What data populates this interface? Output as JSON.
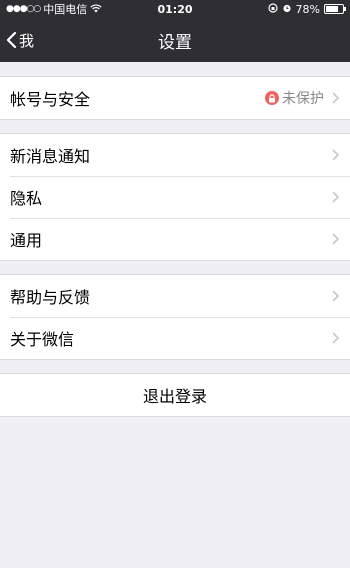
{
  "status_bar": {
    "signal": "●●●○○",
    "carrier": "中国电信",
    "time": "01:20",
    "battery": "78%",
    "battery_level": 0.78
  },
  "navbar": {
    "back_label": "我",
    "title": "设置"
  },
  "groups": [
    [
      {
        "label": "帐号与安全",
        "value": "未保护"
      }
    ],
    [
      {
        "label": "新消息通知"
      },
      {
        "label": "隐私"
      },
      {
        "label": "通用"
      }
    ],
    [
      {
        "label": "帮助与反馈"
      },
      {
        "label": "关于微信"
      }
    ]
  ],
  "logout_label": "退出登录",
  "colors": {
    "navbar_bg": "#2e2e33",
    "page_bg": "#efeff4",
    "lock_badge": "#e96363"
  }
}
